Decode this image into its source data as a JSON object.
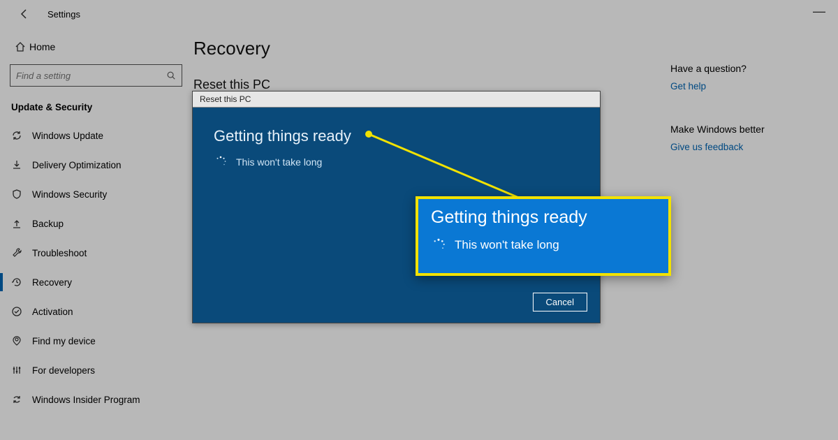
{
  "header": {
    "title": "Settings",
    "minimize_label": "—"
  },
  "sidebar": {
    "home_label": "Home",
    "search_placeholder": "Find a setting",
    "section_label": "Update & Security",
    "items": [
      {
        "label": "Windows Update",
        "icon": "sync-icon"
      },
      {
        "label": "Delivery Optimization",
        "icon": "download-icon"
      },
      {
        "label": "Windows Security",
        "icon": "shield-icon"
      },
      {
        "label": "Backup",
        "icon": "upload-icon"
      },
      {
        "label": "Troubleshoot",
        "icon": "wrench-icon"
      },
      {
        "label": "Recovery",
        "icon": "history-icon"
      },
      {
        "label": "Activation",
        "icon": "check-circle-icon"
      },
      {
        "label": "Find my device",
        "icon": "locate-icon"
      },
      {
        "label": "For developers",
        "icon": "sliders-icon"
      },
      {
        "label": "Windows Insider Program",
        "icon": "cycle-icon"
      }
    ],
    "active_index": 5
  },
  "main": {
    "page_title": "Recovery",
    "section_title": "Reset this PC"
  },
  "modal": {
    "title": "Reset this PC",
    "heading": "Getting things ready",
    "subtext": "This won't take long",
    "cancel_label": "Cancel"
  },
  "callout": {
    "heading": "Getting things ready",
    "subtext": "This won't take long"
  },
  "help": {
    "question_label": "Have a question?",
    "help_link": "Get help",
    "improve_label": "Make Windows better",
    "feedback_link": "Give us feedback"
  },
  "colors": {
    "accent": "#0066b4",
    "modal_bg": "#0a4a7a",
    "callout_bg": "#0a78d4",
    "highlight": "#f2e200"
  }
}
